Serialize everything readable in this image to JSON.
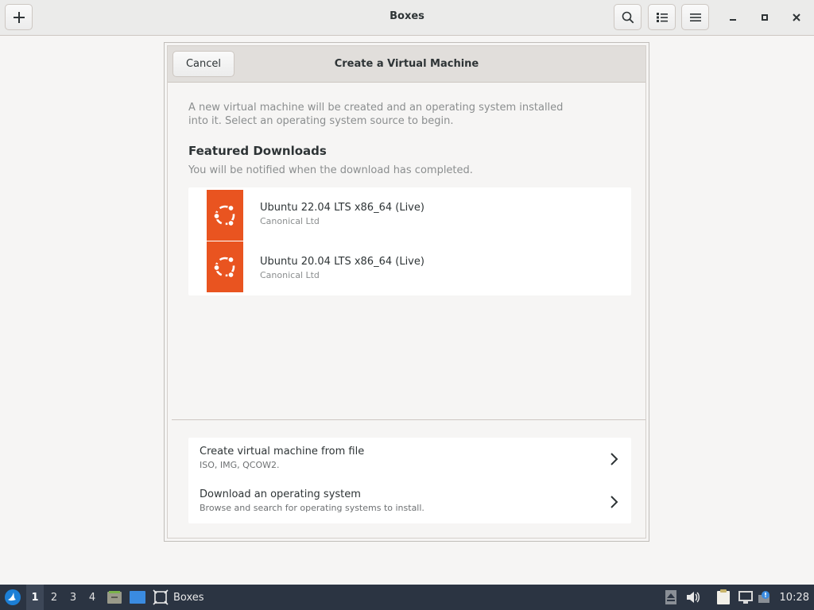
{
  "header": {
    "title": "Boxes",
    "new_icon": "plus-icon",
    "search_icon": "search-icon",
    "view_icon": "list-view-icon",
    "menu_icon": "hamburger-menu-icon",
    "window_controls": {
      "minimize": "minimize-icon",
      "maximize": "maximize-icon",
      "close": "close-icon"
    }
  },
  "dialog": {
    "cancel_label": "Cancel",
    "title": "Create a Virtual Machine",
    "intro_line1": "A new virtual machine will be created and an operating system installed",
    "intro_line2": "into it. Select an operating system source to begin.",
    "featured_title": "Featured Downloads",
    "featured_subtitle": "You will be notified when the download has completed.",
    "downloads": [
      {
        "name": "Ubuntu 22.04 LTS x86_64 (Live)",
        "vendor": "Canonical Ltd",
        "icon": "ubuntu-logo-icon"
      },
      {
        "name": "Ubuntu 20.04 LTS x86_64 (Live)",
        "vendor": "Canonical Ltd",
        "icon": "ubuntu-logo-icon"
      }
    ],
    "actions": [
      {
        "title": "Create virtual machine from file",
        "subtitle": "ISO, IMG, QCOW2.",
        "icon": "chevron-right-icon"
      },
      {
        "title": "Download an operating system",
        "subtitle": "Browse and search for operating systems to install.",
        "icon": "chevron-right-icon"
      }
    ]
  },
  "taskbar": {
    "start_icon": "lubuntu-start-icon",
    "workspaces": [
      "1",
      "2",
      "3",
      "4"
    ],
    "active_workspace": "1",
    "file_manager_icon": "file-manager-icon",
    "desktop_icon": "show-desktop-icon",
    "task_label": "Boxes",
    "task_icon": "boxes-app-icon",
    "tray_icons": [
      "eject-icon",
      "volume-icon",
      "clipboard-icon",
      "network-icon",
      "update-notifier-icon"
    ],
    "clock": "10:28"
  },
  "colors": {
    "accent_ubuntu": "#e95420",
    "taskbar_bg": "#2b3442",
    "window_bg": "#f6f5f4"
  }
}
